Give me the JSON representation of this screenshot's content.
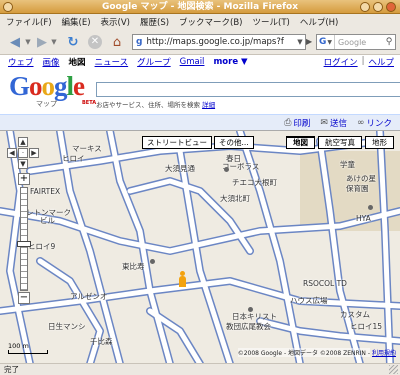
{
  "window": {
    "title": "Google マップ - 地図検索 - Mozilla Firefox"
  },
  "menu": [
    "ファイル(F)",
    "編集(E)",
    "表示(V)",
    "履歴(S)",
    "ブックマーク(B)",
    "ツール(T)",
    "ヘルプ(H)"
  ],
  "toolbar": {
    "url": "http://maps.google.co.jp/maps?f",
    "search_placeholder": "Google"
  },
  "gnav": {
    "links": [
      "ウェブ",
      "画像",
      "地図",
      "ニュース",
      "グループ",
      "Gmail",
      "more ▼"
    ],
    "current": "地図",
    "login": "ログイン",
    "help": "ヘルプ",
    "sep": "|"
  },
  "header": {
    "logo_sub": "マップ",
    "beta": "BETA",
    "search_hint": "お店やサービス、住所、場所を検索",
    "search_hint_link": "詳細"
  },
  "tools": {
    "print": "印刷",
    "send": "送信",
    "link": "リンク"
  },
  "map": {
    "buttons": {
      "streetview": "ストリートビュー",
      "other": "その他...",
      "map": "地図",
      "satellite": "航空写真",
      "terrain": "地形"
    },
    "active_type": "地図",
    "labels": [
      "マーキス",
      "ヒロイ",
      "FAIRTEX",
      "レトンマーク",
      "ビル",
      "ヒロイ9",
      "大須見通",
      "春日",
      "コーボラス",
      "チエコ大根町",
      "大須北町",
      "学童",
      "あけの星",
      "保育園",
      "HYA",
      "東比寿",
      "アルゼンオ",
      "日生マンシ",
      "RSOCOL TD",
      "ハウス広場",
      "カスタム",
      "ヒロイ15",
      "日本キリスト",
      "教団広尾教会",
      "千比森"
    ],
    "scale": "100 m",
    "copyright": "©2008 Google - 地図データ ©2008 ZENRIN -",
    "terms": "利用規約"
  },
  "status": "完了",
  "colors": {
    "road_fill": "#ffffff",
    "road_edge": "#6b86c4",
    "map_bg": "#efebe2",
    "park": "#e3dac4"
  }
}
